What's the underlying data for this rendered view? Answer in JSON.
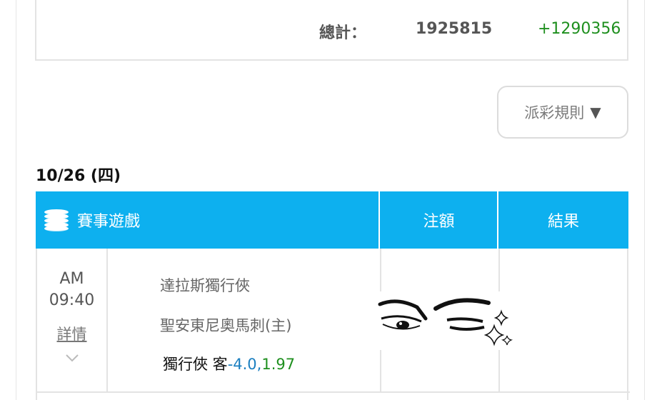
{
  "summary": {
    "label": "總計：",
    "total": "1925815",
    "gain": "+1290356"
  },
  "rules_button": {
    "label": "派彩規則",
    "arrow": "▼"
  },
  "date": "10/26 (四)",
  "table": {
    "headers": [
      "賽事遊戲",
      "注額",
      "結果"
    ],
    "rows": [
      {
        "ampm": "AM",
        "time": "09:40",
        "detail_link": "詳情",
        "team_away": "達拉斯獨行俠",
        "team_home": "聖安東尼奧馬刺(主)",
        "bet_pick": "獨行俠 客",
        "bet_handicap": "-4.0,",
        "bet_odds": "1.97"
      }
    ]
  },
  "icons": [
    "coins-stack-icon",
    "chevron-down-icon",
    "sticker-eyes-icon"
  ],
  "colors": {
    "header_bg": "#0db0ef",
    "gain_green": "#1e8f1e",
    "handicap_blue": "#1b7fc0"
  }
}
